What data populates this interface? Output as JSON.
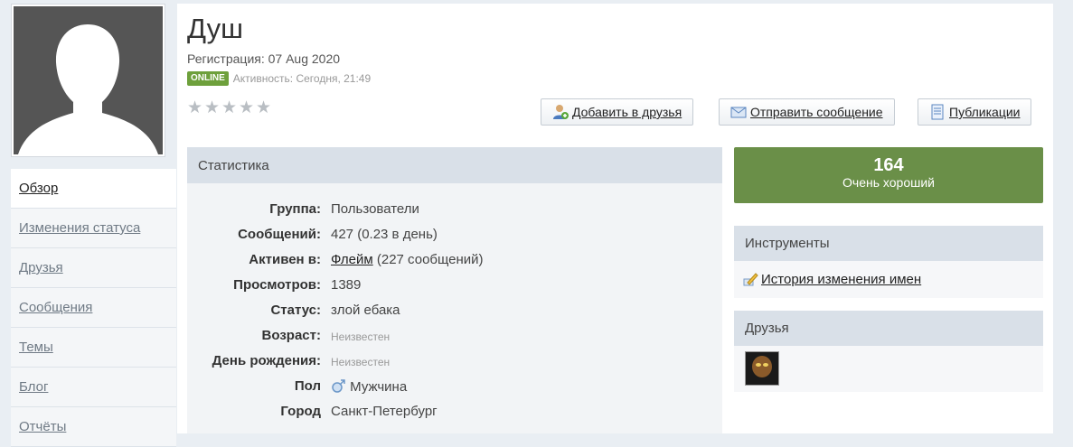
{
  "profile": {
    "name": "Душ",
    "registration": "Регистрация: 07 Aug 2020",
    "online_badge": "ONLINE",
    "activity": "Активность: Сегодня, 21:49",
    "rating_stars": 0
  },
  "buttons": {
    "add_friend": " Добавить в друзья",
    "send_message": " Отправить сообщение",
    "publications": " Публикации"
  },
  "nav": {
    "items": [
      {
        "label": "Обзор"
      },
      {
        "label": "Изменения статуса"
      },
      {
        "label": "Друзья"
      },
      {
        "label": "Сообщения"
      },
      {
        "label": "Темы"
      },
      {
        "label": "Блог"
      },
      {
        "label": "Отчёты"
      }
    ]
  },
  "stats": {
    "title": "Статистика",
    "rows": [
      {
        "label": "Группа:",
        "value": "Пользователи"
      },
      {
        "label": "Сообщений:",
        "value": "427 (0.23 в день)"
      },
      {
        "label": "Активен в:",
        "link": "Флейм",
        "value": " (227 сообщений)"
      },
      {
        "label": "Просмотров:",
        "value": "1389"
      },
      {
        "label": "Статус:",
        "value": "злой ебака"
      },
      {
        "label": "Возраст:",
        "value": "Неизвестен"
      },
      {
        "label": "День рождения:",
        "value": "Неизвестен"
      },
      {
        "label": "Пол",
        "value": " Мужчина"
      },
      {
        "label": "Город",
        "value": "Санкт-Петербург"
      }
    ]
  },
  "reputation": {
    "value": "164",
    "label": "Очень хороший",
    "color": "#6a8f48"
  },
  "tools": {
    "title": "Инструменты",
    "name_history": " История изменения имен"
  },
  "friends": {
    "title": "Друзья"
  }
}
